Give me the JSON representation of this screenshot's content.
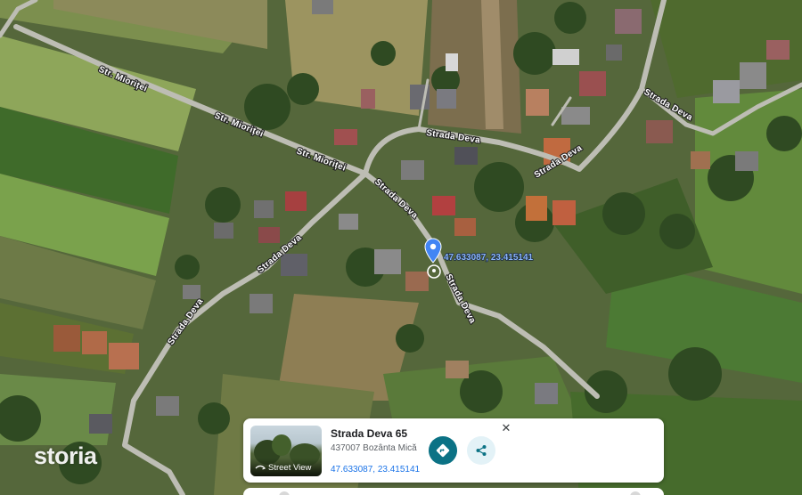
{
  "map": {
    "road_labels": {
      "miorita_1": "Str. Mioriței",
      "miorita_2": "Str. Mioriței",
      "miorita_3": "Str. Mioriței",
      "deva_1": "Strada Deva",
      "deva_2": "Strada Deva",
      "deva_3": "Strada Deva",
      "deva_4": "Strada Deva",
      "deva_5": "Strada Deva",
      "deva_6": "Strada Deva",
      "deva_7": "Strada Deva"
    },
    "pin_coordinates": "47.633087, 23.415141",
    "pin_color": "#4285f4"
  },
  "watermark": "storia",
  "info_card": {
    "title": "Strada Deva 65",
    "address": "437007 Bozânta Mică",
    "coordinates": "47.633087, 23.415141",
    "street_view_label": "Street View",
    "directions_icon": "directions-icon",
    "share_icon": "share-icon",
    "close_icon": "close-icon",
    "close_glyph": "✕",
    "accent_color": "#0b7285"
  }
}
